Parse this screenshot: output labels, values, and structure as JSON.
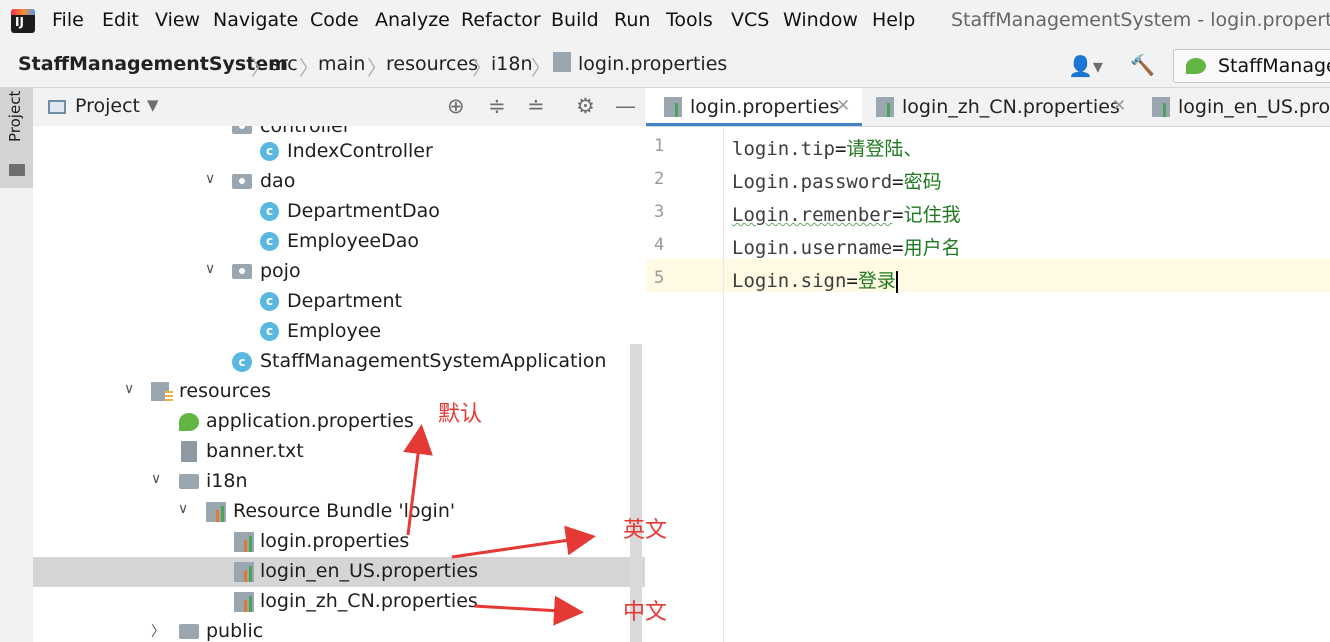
{
  "menubar": {
    "items": [
      "File",
      "Edit",
      "View",
      "Navigate",
      "Code",
      "Analyze",
      "Refactor",
      "Build",
      "Run",
      "Tools",
      "VCS",
      "Window",
      "Help"
    ],
    "window_title": "StaffManagementSystem - login.properties"
  },
  "breadcrumb": {
    "items": [
      "StaffManagementSystem",
      "src",
      "main",
      "resources",
      "i18n",
      "login.properties"
    ],
    "run_config": "StaffManager"
  },
  "sidebar": {
    "stripe_tab": "Project"
  },
  "project_panel": {
    "title": "Project",
    "tree": [
      {
        "label": "controller"
      },
      {
        "label": "IndexController"
      },
      {
        "label": "dao"
      },
      {
        "label": "DepartmentDao"
      },
      {
        "label": "EmployeeDao"
      },
      {
        "label": "pojo"
      },
      {
        "label": "Department"
      },
      {
        "label": "Employee"
      },
      {
        "label": "StaffManagementSystemApplication"
      },
      {
        "label": "resources"
      },
      {
        "label": "application.properties"
      },
      {
        "label": "banner.txt"
      },
      {
        "label": "i18n"
      },
      {
        "label": "Resource Bundle 'login'"
      },
      {
        "label": "login.properties"
      },
      {
        "label": "login_en_US.properties"
      },
      {
        "label": "login_zh_CN.properties"
      },
      {
        "label": "public"
      }
    ],
    "selected_item": "login_en_US.properties"
  },
  "editor": {
    "tabs": [
      {
        "label": "login.properties",
        "active": true
      },
      {
        "label": "login_zh_CN.properties",
        "active": false
      },
      {
        "label": "login_en_US.prope",
        "active": false
      }
    ],
    "line_numbers": [
      "1",
      "2",
      "3",
      "4",
      "5"
    ],
    "lines": [
      {
        "key": "login.tip",
        "value": "请登陆、"
      },
      {
        "key": "Login.password",
        "value": "密码"
      },
      {
        "key": "Login.remenber",
        "value": "记住我"
      },
      {
        "key": "Login.username",
        "value": "用户名"
      },
      {
        "key": "Login.sign",
        "value": "登录"
      }
    ],
    "equals": "=",
    "current_line": 5
  },
  "annotations": {
    "default": "默认",
    "english": "英文",
    "chinese": "中文",
    "color": "#e53935"
  }
}
